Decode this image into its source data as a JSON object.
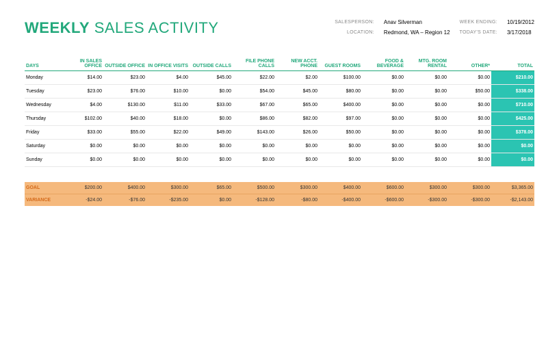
{
  "title": {
    "bold": "WEEKLY",
    "light": " SALES ACTIVITY"
  },
  "meta": {
    "salesperson_label": "SALESPERSON:",
    "salesperson": "Anav Silverman",
    "location_label": "LOCATION:",
    "location": "Redmond, WA – Region 12",
    "weekending_label": "WEEK ENDING:",
    "weekending": "10/19/2012",
    "today_label": "TODAY'S DATE:",
    "today": "3/17/2018"
  },
  "columns": [
    "DAYS",
    "IN SALES OFFICE",
    "OUTSIDE OFFICE",
    "IN OFFICE VISITS",
    "OUTSIDE CALLS",
    "FILE PHONE CALLS",
    "NEW ACCT. PHONE",
    "GUEST ROOMS",
    "FOOD & BEVERAGE",
    "MTG. ROOM RENTAL",
    "OTHER*",
    "TOTAL"
  ],
  "rows": [
    {
      "day": "Monday",
      "v": [
        "$14.00",
        "$23.00",
        "$4.00",
        "$45.00",
        "$22.00",
        "$2.00",
        "$100.00",
        "$0.00",
        "$0.00",
        "$0.00",
        "$210.00"
      ]
    },
    {
      "day": "Tuesday",
      "v": [
        "$23.00",
        "$76.00",
        "$10.00",
        "$0.00",
        "$54.00",
        "$45.00",
        "$80.00",
        "$0.00",
        "$0.00",
        "$50.00",
        "$338.00"
      ]
    },
    {
      "day": "Wednesday",
      "v": [
        "$4.00",
        "$130.00",
        "$11.00",
        "$33.00",
        "$67.00",
        "$65.00",
        "$400.00",
        "$0.00",
        "$0.00",
        "$0.00",
        "$710.00"
      ]
    },
    {
      "day": "Thursday",
      "v": [
        "$102.00",
        "$40.00",
        "$18.00",
        "$0.00",
        "$86.00",
        "$82.00",
        "$97.00",
        "$0.00",
        "$0.00",
        "$0.00",
        "$425.00"
      ]
    },
    {
      "day": "Friday",
      "v": [
        "$33.00",
        "$55.00",
        "$22.00",
        "$49.00",
        "$143.00",
        "$26.00",
        "$50.00",
        "$0.00",
        "$0.00",
        "$0.00",
        "$378.00"
      ]
    },
    {
      "day": "Saturday",
      "v": [
        "$0.00",
        "$0.00",
        "$0.00",
        "$0.00",
        "$0.00",
        "$0.00",
        "$0.00",
        "$0.00",
        "$0.00",
        "$0.00",
        "$0.00"
      ]
    },
    {
      "day": "Sunday",
      "v": [
        "$0.00",
        "$0.00",
        "$0.00",
        "$0.00",
        "$0.00",
        "$0.00",
        "$0.00",
        "$0.00",
        "$0.00",
        "$0.00",
        "$0.00"
      ]
    }
  ],
  "goal_label": "GOAL",
  "goal": [
    "$200.00",
    "$400.00",
    "$300.00",
    "$65.00",
    "$500.00",
    "$300.00",
    "$400.00",
    "$600.00",
    "$300.00",
    "$300.00",
    "$3,365.00"
  ],
  "variance_label": "VARIANCE",
  "variance": [
    "-$24.00",
    "-$76.00",
    "-$235.00",
    "$0.00",
    "-$128.00",
    "-$80.00",
    "-$400.00",
    "-$600.00",
    "-$300.00",
    "-$300.00",
    "-$2,143.00"
  ]
}
